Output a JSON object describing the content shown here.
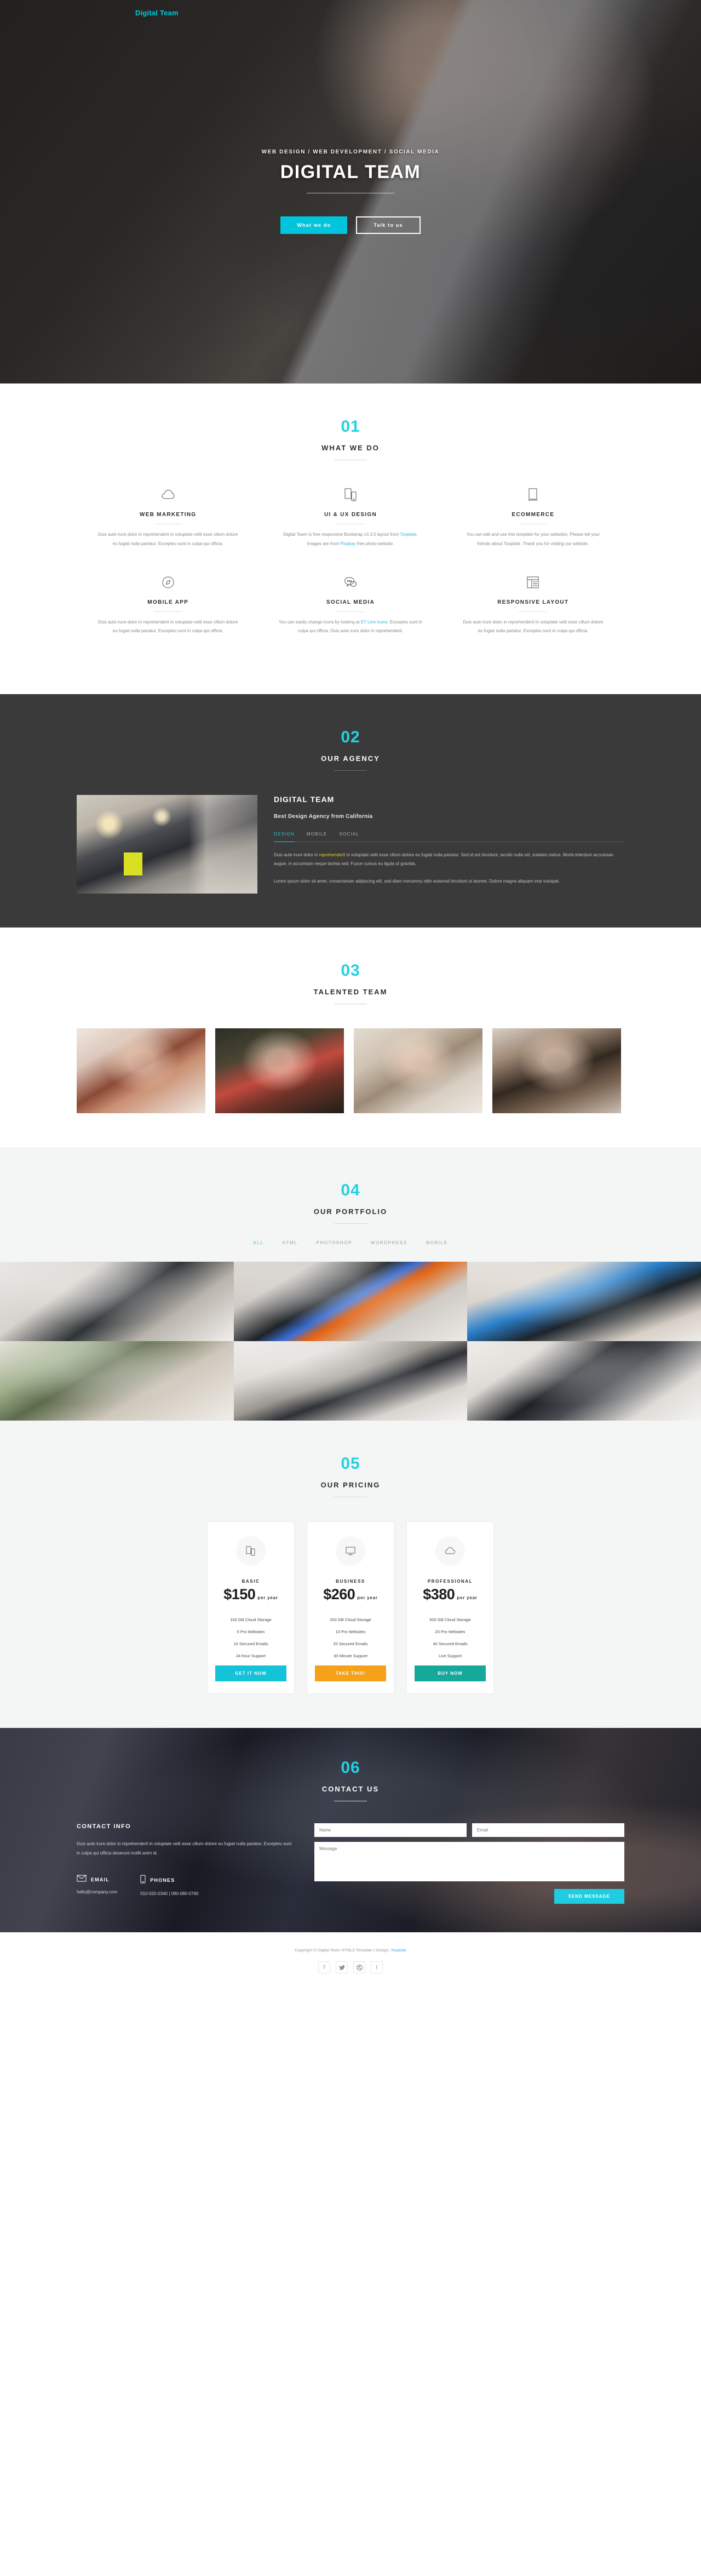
{
  "brand": "Digital Team",
  "hero": {
    "subtitle": "WEB DESIGN / WEB DEVELOPMENT / SOCIAL MEDIA",
    "title": "DIGITAL TEAM",
    "btn_primary": "What we do",
    "btn_secondary": "Talk to us"
  },
  "services": {
    "number": "01",
    "title": "WHAT WE DO",
    "items": [
      {
        "icon": "cloud-icon",
        "name": "WEB MARKETING",
        "text": "Duis aute irure dolor in reprehenderit in voluptate velit esse cillum dolore eu fugiat nulla pariatur. Excepteu sunt in culpa qui officia."
      },
      {
        "icon": "devices-icon",
        "name": "UI & UX DESIGN",
        "text_before": "Digital Team is free responsive Bootstrap v3.3.5 layout from ",
        "link1": "Tooplate",
        "text_mid": ". Images are from ",
        "link2": "Pixabay",
        "text_after": " free photo website."
      },
      {
        "icon": "tablet-icon",
        "name": "ECOMMERCE",
        "text": "You can edit and use this template for your websites. Please tell your friends about Tooplate. Thank you for visiting our website."
      },
      {
        "icon": "compass-icon",
        "name": "MOBILE APP",
        "text": "Duis aute irure dolor in reprehenderit in voluptate velit esse cillum dolore eu fugiat nulla pariatur. Excepteu sunt in culpa qui officia."
      },
      {
        "icon": "chat-bubble-icon",
        "name": "SOCIAL MEDIA",
        "text_before": "You can easily change icons by looking at ",
        "link1": "ET Line Icons",
        "text_after": ". Excepteu sunt in culpa qui officia. Duis aute irure dolor in reprehenderit."
      },
      {
        "icon": "layout-icon",
        "name": "RESPONSIVE LAYOUT",
        "text": "Duis aute irure dolor in reprehenderit in voluptate velit esse cillum dolore eu fugiat nulla pariatur. Excepteu sunt in culpa qui officia."
      }
    ]
  },
  "agency": {
    "number": "02",
    "title": "OUR AGENCY",
    "heading": "DIGITAL TEAM",
    "subheading": "Best Design Agency from California",
    "tabs": [
      "DESIGN",
      "MOBILE",
      "SOCIAL"
    ],
    "active_tab": "DESIGN",
    "para1_a": "Duis aute irure dolor in ",
    "para1_hl": "reprehenderit",
    "para1_b": " in voluptate velit esse cillum dolore eu fugiat nulla pariatur. Sed id est tincidunt, iaculis nulla vel, sodales metus. Morbi interdum accumsan augue, in accumsan neque lacinia sed. Fusce cursus eu ligula ut gravida.",
    "para2": "Lorem ipsum dolor sit amet, consectetuer adipiscing elit, sed diam nonummy nibh euismod tincidunt ut laoreet. Dolore magna aliquam erat volutpat."
  },
  "team": {
    "number": "03",
    "title": "TALENTED TEAM",
    "members": [
      "team-photo-1",
      "team-photo-2",
      "team-photo-3",
      "team-photo-4"
    ]
  },
  "portfolio": {
    "number": "04",
    "title": "OUR PORTFOLIO",
    "filters": [
      "ALL",
      "HTML",
      "PHOTOSHOP",
      "WORDPRESS",
      "MOBILE"
    ],
    "active_filter": "ALL",
    "items": [
      "portfolio-item-1",
      "portfolio-item-2",
      "portfolio-item-3",
      "portfolio-item-4",
      "portfolio-item-5",
      "portfolio-item-6"
    ]
  },
  "pricing": {
    "number": "05",
    "title": "OUR PRICING",
    "per": "per year",
    "plans": [
      {
        "icon": "devices-icon",
        "plan": "BASIC",
        "amount": "$150",
        "features": [
          "100 GB Cloud Storage",
          "5 Pro Websites",
          "10 Secured Emails",
          "24-hour Support"
        ],
        "cta": "GET IT NOW",
        "color": "#14c3d8"
      },
      {
        "icon": "monitor-icon",
        "plan": "BUSINESS",
        "amount": "$260",
        "features": [
          "200 GB Cloud Storage",
          "10 Pro Websites",
          "20 Secured Emails",
          "30-Minute Support"
        ],
        "cta": "TAKE THIS!",
        "color": "#f5a218"
      },
      {
        "icon": "cloud-icon",
        "plan": "PROFESSIONAL",
        "amount": "$380",
        "features": [
          "500 GB Cloud Storage",
          "20 Pro Websites",
          "40 Secured Emails",
          "Live Support"
        ],
        "cta": "BUY NOW",
        "color": "#16a89b"
      }
    ]
  },
  "contact": {
    "number": "06",
    "title": "CONTACT US",
    "info_heading": "CONTACT INFO",
    "info_text": "Duis aute irure dolor in reprehenderit in voluptate velit esse cillum dolore eu fugiat nulla pariatur. Excepteu sunt in culpa qui officia deserunt mollit anim id.",
    "email_label": "EMAIL",
    "email_value": "hello@company.com",
    "phones_label": "PHONES",
    "phones_value": "010-020-0340 | 090-080-0760",
    "name_placeholder": "Name",
    "email_placeholder": "Email",
    "message_placeholder": "Message",
    "send_label": "SEND MESSAGE"
  },
  "footer": {
    "copyright_a": "Copyright © Digital Team HTML5 Template | Design: ",
    "copyright_link": "Tooplate",
    "socials": [
      "facebook-icon",
      "twitter-icon",
      "dribbble-icon",
      "tumblr-icon"
    ]
  },
  "colors": {
    "accent": "#22d2e0",
    "dark": "#3a3a3a",
    "orange": "#f5a218",
    "teal": "#16a89b"
  }
}
